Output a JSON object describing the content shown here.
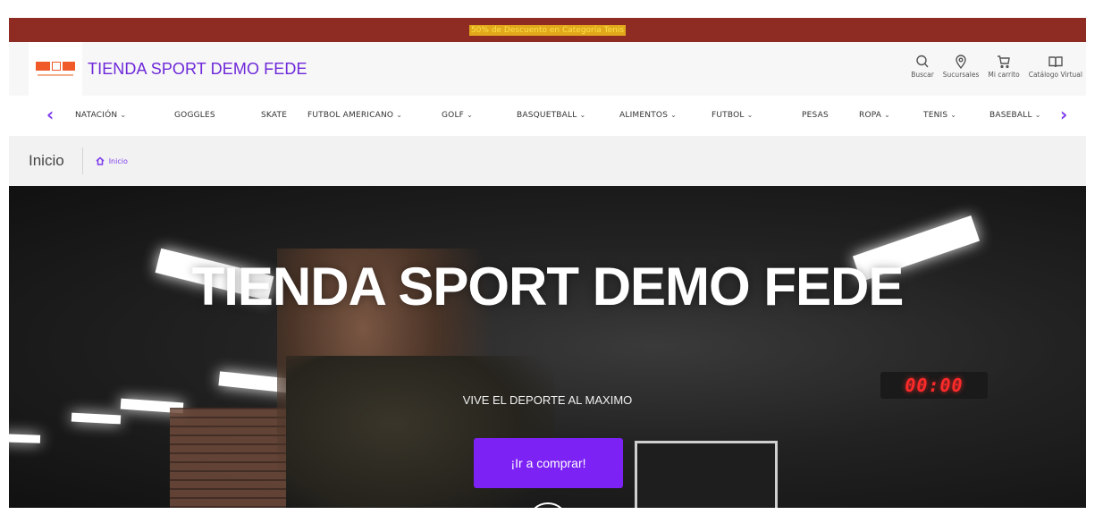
{
  "promo": {
    "text": "50% de Descuento en Categoría Tenis"
  },
  "header": {
    "brand": "TIENDA SPORT DEMO FEDE",
    "tools": [
      {
        "label": "Buscar",
        "icon": "search-icon"
      },
      {
        "label": "Sucursales",
        "icon": "location-pin-icon"
      },
      {
        "label": "Mi carrito",
        "icon": "cart-icon"
      },
      {
        "label": "Catálogo Virtual",
        "icon": "book-icon"
      }
    ]
  },
  "nav": {
    "items": [
      {
        "label": "NATACIÓN",
        "dropdown": true
      },
      {
        "label": "GOGGLES",
        "dropdown": false
      },
      {
        "label": "SKATE",
        "dropdown": false
      },
      {
        "label": "FUTBOL AMERICANO",
        "dropdown": true
      },
      {
        "label": "GOLF",
        "dropdown": true
      },
      {
        "label": "BASQUETBALL",
        "dropdown": true
      },
      {
        "label": "ALIMENTOS",
        "dropdown": true
      },
      {
        "label": "FUTBOL",
        "dropdown": true
      },
      {
        "label": "PESAS",
        "dropdown": false
      },
      {
        "label": "ROPA",
        "dropdown": true
      },
      {
        "label": "TENIS",
        "dropdown": true
      },
      {
        "label": "BASEBALL",
        "dropdown": true
      }
    ]
  },
  "breadcrumb": {
    "title": "Inicio",
    "home_label": "Inicio"
  },
  "hero": {
    "title": "TIENDA SPORT DEMO FEDE",
    "subtitle": "VIVE EL DEPORTE AL MAXIMO",
    "cta_label": "¡Ir a comprar!",
    "timer": "00:00"
  },
  "colors": {
    "accent": "#7c22f5",
    "promo_bg": "#8e2b23",
    "brand_text": "#6d28d9"
  }
}
